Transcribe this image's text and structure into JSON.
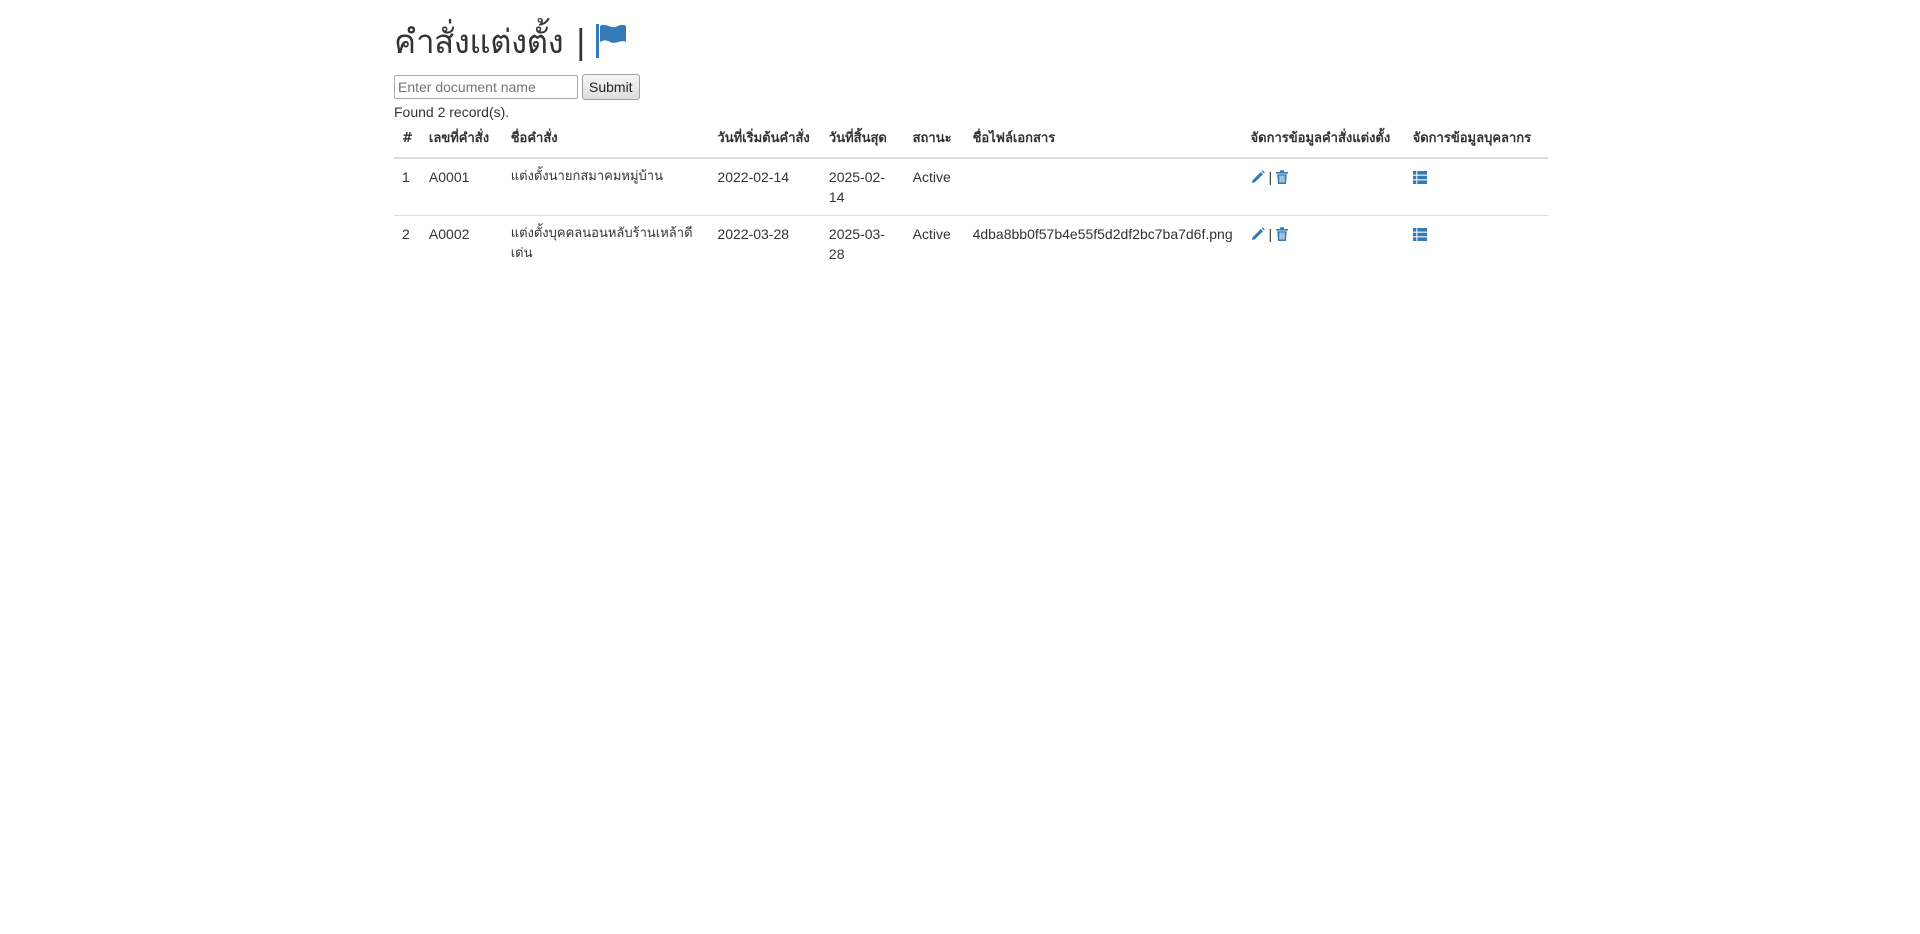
{
  "header": {
    "title": "คำสั่งแต่งตั้ง",
    "separator": "|",
    "icon": "flag-icon"
  },
  "search": {
    "placeholder": "Enter document name",
    "value": "",
    "submit_label": "Submit"
  },
  "result_text": "Found 2 record(s).",
  "table": {
    "columns": [
      "#",
      "เลขที่คำสั่ง",
      "ชื่อคำสั่ง",
      "วันที่เริ่มต้นคำสั่ง",
      "วันที่สิ้นสุด",
      "สถานะ",
      "ชื่อไฟล์เอกสาร",
      "จัดการข้อมูลคำสั่งแต่งตั้ง",
      "จัดการข้อมูลบุคลากร"
    ],
    "rows": [
      {
        "num": "1",
        "code": "A0001",
        "name": "แต่งตั้งนายกสมาคมหมู่บ้าน",
        "start": "2022-02-14",
        "end": "2025-02-14",
        "status": "Active",
        "file": ""
      },
      {
        "num": "2",
        "code": "A0002",
        "name": "แต่งตั้งบุคคลนอนหลับร้านเหล้าดีเด่น",
        "start": "2022-03-28",
        "end": "2025-03-28",
        "status": "Active",
        "file": "4dba8bb0f57b4e55f5d2df2bc7ba7d6f.png"
      }
    ],
    "action_separator": "|",
    "icons": {
      "edit": "pencil-icon",
      "delete": "trash-icon",
      "staff": "list-icon"
    }
  },
  "colors": {
    "accent": "#337ab7",
    "text": "#333333",
    "border": "#dddddd"
  }
}
